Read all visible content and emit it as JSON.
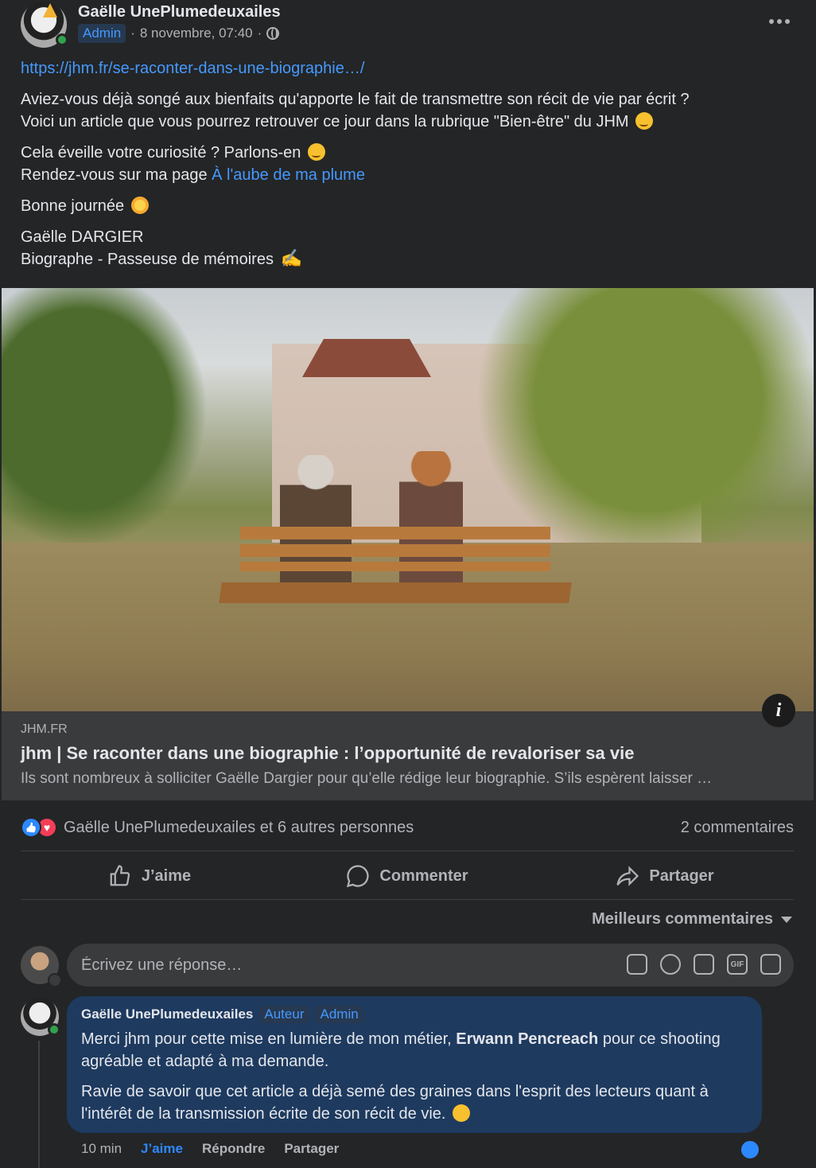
{
  "post": {
    "author": "Gaëlle UnePlumedeuxailes",
    "badge": "Admin",
    "date": "8 novembre, 07:40"
  },
  "body": {
    "link": "https://jhm.fr/se-raconter-dans-une-biographie…/",
    "p1_line1": "Aviez-vous déjà songé aux bienfaits qu'apporte le fait de transmettre son récit de vie par écrit ?",
    "p1_line2": "Voici un article que vous pourrez retrouver ce jour dans la rubrique \"Bien-être\" du JHM",
    "p2_line1": "Cela éveille votre curiosité ? Parlons-en",
    "p2_line2_prefix": "Rendez-vous sur ma page",
    "page_link": "À l'aube de ma plume",
    "p3": "Bonne journée",
    "signature_name": "Gaëlle DARGIER",
    "signature_title": "Biographe - Passeuse de mémoires"
  },
  "link_card": {
    "domain": "JHM.FR",
    "title": "jhm | Se raconter dans une biographie : l’opportunité de revaloriser sa vie",
    "description": "Ils sont nombreux à solliciter Gaëlle Dargier pour qu’elle rédige leur biographie. S’ils espèrent laisser …"
  },
  "reactions": {
    "text": "Gaëlle UnePlumedeuxailes et 6 autres personnes",
    "comments": "2 commentaires"
  },
  "actions": {
    "like": "J’aime",
    "comment": "Commenter",
    "share": "Partager"
  },
  "sort_label": "Meilleurs commentaires",
  "composer": {
    "placeholder": "Écrivez une réponse…",
    "gif": "GIF"
  },
  "comment": {
    "author": "Gaëlle UnePlumedeuxailes",
    "tag_author": "Auteur",
    "tag_admin": "Admin",
    "line1_a": "Merci jhm pour cette mise en lumière de mon métier,",
    "mention": "Erwann Pencreach",
    "line1_b": "pour ce shooting agréable et adapté à ma demande.",
    "p2": "Ravie de savoir que cet article a déjà semé des graines dans l'esprit des lecteurs quant à l'intérêt de la transmission écrite de son récit de vie.",
    "time": "10 min",
    "like": "J’aime",
    "reply": "Répondre",
    "share": "Partager"
  }
}
